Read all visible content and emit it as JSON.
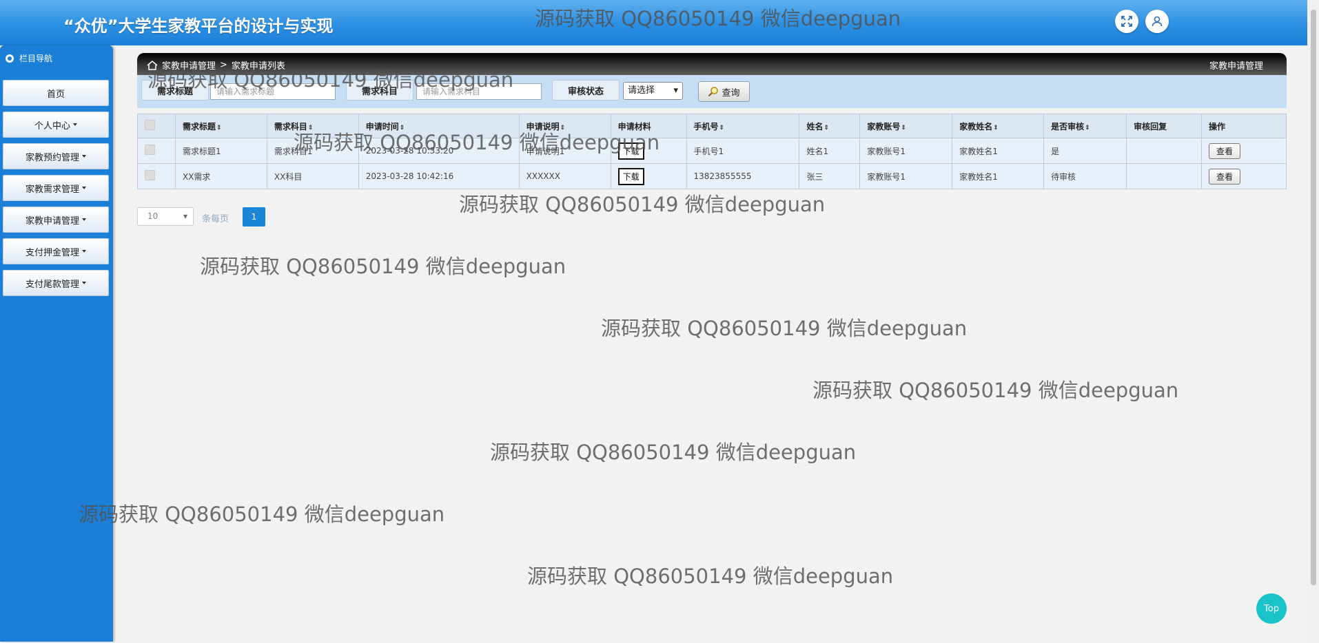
{
  "header": {
    "title": "“众优”大学生家教平台的设计与实现"
  },
  "icons": {
    "fullscreen": "fullscreen-icon",
    "user": "user-icon",
    "home": "home-icon",
    "search": "search-icon"
  },
  "sidebar": {
    "nav_title": "栏目导航",
    "items": [
      {
        "label": "首页"
      },
      {
        "label": "个人中心"
      },
      {
        "label": "家教预约管理"
      },
      {
        "label": "家教需求管理"
      },
      {
        "label": "家教申请管理"
      },
      {
        "label": "支付押金管理"
      },
      {
        "label": "支付尾款管理"
      }
    ]
  },
  "breadcrumb": {
    "parent": "家教申请管理",
    "separator": ">",
    "current": "家教申请列表",
    "right_title": "家教申请管理"
  },
  "search": {
    "title_label": "需求标题",
    "title_placeholder": "请输入需求标题",
    "subject_label": "需求科目",
    "subject_placeholder": "请输入需求科目",
    "status_label": "审核状态",
    "status_select": "请选择",
    "query_button": "查询"
  },
  "table": {
    "columns": [
      "需求标题",
      "需求科目",
      "申请时间",
      "申请说明",
      "申请材料",
      "手机号",
      "姓名",
      "家教账号",
      "家教姓名",
      "是否审核",
      "审核回复",
      "操作"
    ],
    "sort_glyph": "⇕",
    "download_label": "下载",
    "view_label": "查看",
    "rows": [
      {
        "title": "需求标题1",
        "subject": "需求科目1",
        "time": "2023-03-28 10:33:20",
        "desc": "申请说明1",
        "phone": "手机号1",
        "name": "姓名1",
        "account": "家教账号1",
        "tutor": "家教姓名1",
        "audit": "是",
        "reply": ""
      },
      {
        "title": "XX需求",
        "subject": "XX科目",
        "time": "2023-03-28 10:42:16",
        "desc": "XXXXXX",
        "phone": "13823855555",
        "name": "张三",
        "account": "家教账号1",
        "tutor": "家教姓名1",
        "audit": "待审核",
        "reply": ""
      }
    ]
  },
  "pager": {
    "page_size": "10",
    "per_page_text": "条每页",
    "current_page": "1"
  },
  "top_button": "Top",
  "watermark": "源码获取 QQ86050149 微信deepguan",
  "colors": {
    "header": "#2b8fe3",
    "sidebar": "#1b7fd8",
    "accent": "#1a86d8",
    "top_button": "#1ac3c9"
  }
}
